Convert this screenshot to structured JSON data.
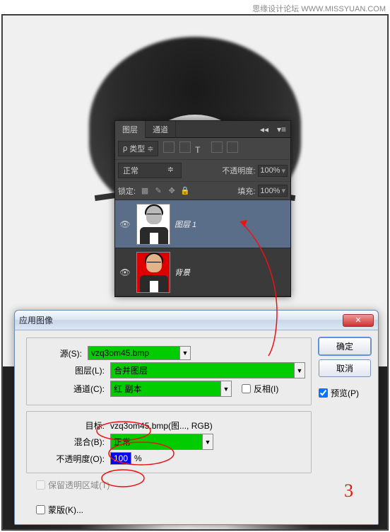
{
  "watermark": "思缘设计论坛 WWW.MISSYUAN.COM",
  "layersPanel": {
    "tabs": [
      "图层",
      "通道"
    ],
    "filter_label": "类型",
    "blend_mode": "正常",
    "opacity_label": "不透明度:",
    "opacity_value": "100%",
    "lock_label": "锁定:",
    "fill_label": "填充:",
    "fill_value": "100%",
    "layers": [
      {
        "name": "图层 1",
        "selected": true,
        "bg": "white"
      },
      {
        "name": "背景",
        "selected": false,
        "bg": "red"
      }
    ]
  },
  "dialog": {
    "title": "应用图像",
    "source_label": "源(S):",
    "source_value": "vzq3om45.bmp",
    "layer_label": "图层(L):",
    "layer_value": "合并图层",
    "channel_label": "通道(C):",
    "channel_value": "红 副本",
    "invert_label": "反相(I)",
    "target_label": "目标:",
    "target_value": "vzq3om45.bmp(图..., RGB)",
    "blend_label": "混合(B):",
    "blend_value": "正常",
    "opacity_label": "不透明度(O):",
    "opacity_value": "100",
    "percent": "%",
    "preserve_label": "保留透明区域(T)",
    "mask_label": "蒙版(K)...",
    "ok": "确定",
    "cancel": "取消",
    "preview": "预览(P)"
  },
  "annotation_number": "3"
}
